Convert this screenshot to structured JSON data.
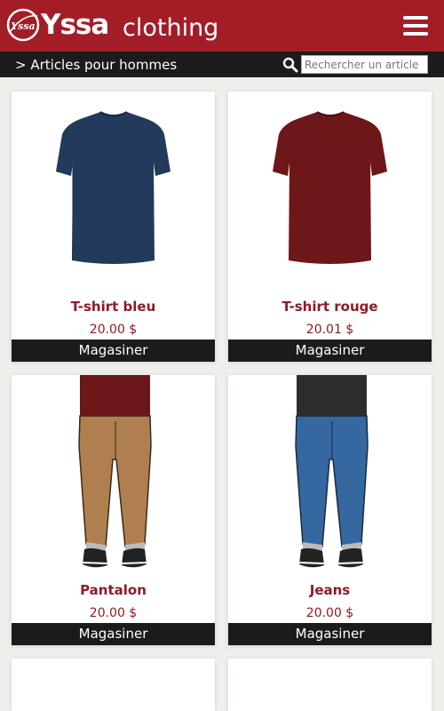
{
  "header": {
    "logo_text": "Yssa",
    "brand": "Yssa",
    "brand_sub": "clothing",
    "menu_icon": "hamburger-icon",
    "background": "#a31d27"
  },
  "subbar": {
    "breadcrumb": "> Articles pour hommes",
    "search_icon": "search-icon",
    "search_placeholder": "Rechercher un article",
    "background": "#1b1b1b"
  },
  "products": [
    {
      "name": "T-shirt bleu",
      "price": "20.00 $",
      "shop_label": "Magasiner",
      "image": "blue-tshirt",
      "color": "#223a5b"
    },
    {
      "name": "T-shirt rouge",
      "price": "20.01 $",
      "shop_label": "Magasiner",
      "image": "red-tshirt",
      "color": "#6d1719"
    },
    {
      "name": "Pantalon",
      "price": "20.00 $",
      "shop_label": "Magasiner",
      "image": "khaki-pants",
      "color": "#b07f4f"
    },
    {
      "name": "Jeans",
      "price": "20.00 $",
      "shop_label": "Magasiner",
      "image": "blue-jeans",
      "color": "#3567a0"
    }
  ],
  "colors": {
    "accent": "#a31d27",
    "product_text": "#8e1b24",
    "page_bg": "#eeeeea"
  }
}
